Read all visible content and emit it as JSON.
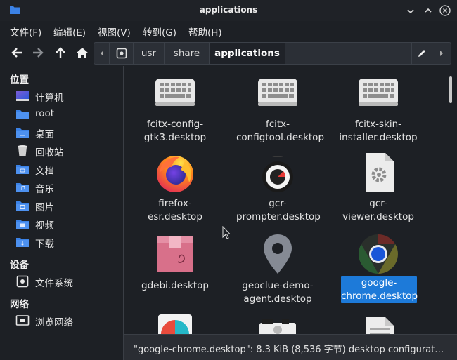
{
  "window": {
    "title": "applications"
  },
  "menu": [
    "文件(F)",
    "编辑(E)",
    "视图(V)",
    "转到(G)",
    "帮助(H)"
  ],
  "path": {
    "segments": [
      "usr",
      "share",
      "applications"
    ]
  },
  "sidebar": {
    "places_heading": "位置",
    "places": [
      {
        "label": "计算机",
        "icon": "computer-icon"
      },
      {
        "label": "root",
        "icon": "folder-home-icon"
      },
      {
        "label": "桌面",
        "icon": "desktop-folder-icon"
      },
      {
        "label": "回收站",
        "icon": "trash-icon"
      },
      {
        "label": "文档",
        "icon": "documents-folder-icon"
      },
      {
        "label": "音乐",
        "icon": "music-folder-icon"
      },
      {
        "label": "图片",
        "icon": "pictures-folder-icon"
      },
      {
        "label": "视频",
        "icon": "videos-folder-icon"
      },
      {
        "label": "下载",
        "icon": "downloads-folder-icon"
      }
    ],
    "devices_heading": "设备",
    "devices": [
      {
        "label": "文件系统",
        "icon": "drive-icon"
      }
    ],
    "network_heading": "网络",
    "network": [
      {
        "label": "浏览网络",
        "icon": "network-icon"
      }
    ]
  },
  "files": [
    {
      "name": "fcitx-config-gtk3.desktop",
      "lines": [
        "fcitx-config-",
        "gtk3.desktop"
      ],
      "icon": "keyboard-icon",
      "selected": false
    },
    {
      "name": "fcitx-configtool.desktop",
      "lines": [
        "fcitx-",
        "configtool.desktop"
      ],
      "icon": "keyboard-icon",
      "selected": false
    },
    {
      "name": "fcitx-skin-installer.desktop",
      "lines": [
        "fcitx-skin-",
        "installer.desktop"
      ],
      "icon": "keyboard-icon",
      "selected": false
    },
    {
      "name": "firefox-esr.desktop",
      "lines": [
        "firefox-esr.desktop"
      ],
      "icon": "firefox-icon",
      "selected": false
    },
    {
      "name": "gcr-prompter.desktop",
      "lines": [
        "gcr-",
        "prompter.desktop"
      ],
      "icon": "gcr-prompter-icon",
      "selected": false
    },
    {
      "name": "gcr-viewer.desktop",
      "lines": [
        "gcr-viewer.desktop"
      ],
      "icon": "settings-file-icon",
      "selected": false
    },
    {
      "name": "gdebi.desktop",
      "lines": [
        "gdebi.desktop"
      ],
      "icon": "package-icon",
      "selected": false
    },
    {
      "name": "geoclue-demo-agent.desktop",
      "lines": [
        "geoclue-demo-",
        "agent.desktop"
      ],
      "icon": "location-pin-icon",
      "selected": false
    },
    {
      "name": "google-chrome.desktop",
      "lines": [
        "google-",
        "chrome.desktop"
      ],
      "icon": "chrome-icon",
      "selected": true
    },
    {
      "name": "",
      "lines": [],
      "icon": "chart-app-icon",
      "selected": false
    },
    {
      "name": "",
      "lines": [],
      "icon": "camera-app-icon",
      "selected": false
    },
    {
      "name": "",
      "lines": [],
      "icon": "text-file-icon",
      "selected": false
    }
  ],
  "status": {
    "text": "\"google-chrome.desktop\": 8.3 KiB (8,536 字节) desktop configurat…"
  },
  "colors": {
    "accent": "#1d7ad9",
    "folder": "#3b82e6",
    "background": "#1d2025"
  }
}
